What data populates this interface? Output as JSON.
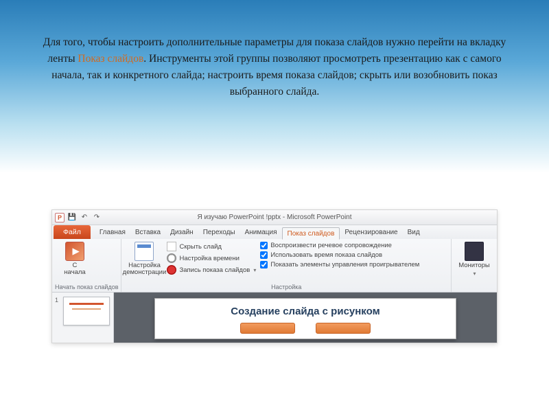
{
  "description": {
    "line1_pre": "Для того, чтобы настроить дополнительные параметры для показа слайдов нужно перейти на вкладку ленты ",
    "highlight": "Показ слайдов",
    "line1_post": ".",
    "line2": "Инструменты этой группы позволяют просмотреть презентацию как с самого начала, так и конкретного слайда; настроить время показа слайдов; скрыть или возобновить показ выбранного слайда."
  },
  "titlebar": {
    "title": "Я изучаю PowerPoint !pptx  -  Microsoft PowerPoint"
  },
  "tabs": {
    "file": "Файл",
    "items": [
      "Главная",
      "Вставка",
      "Дизайн",
      "Переходы",
      "Анимация",
      "Показ слайдов",
      "Рецензирование",
      "Вид"
    ],
    "active_index": 5
  },
  "ribbon": {
    "start_group": {
      "from_beginning": "С\nначала",
      "label": "Начать показ слайдов"
    },
    "setup_group": {
      "setup_btn": "Настройка\nдемонстрации",
      "hide": "Скрыть слайд",
      "rehearse": "Настройка времени",
      "record": "Запись показа слайдов",
      "chk_narration": "Воспроизвести речевое сопровождение",
      "chk_timings": "Использовать время показа слайдов",
      "chk_controls": "Показать элементы управления проигрывателем",
      "label": "Настройка"
    },
    "monitors_group": {
      "monitors": "Мониторы"
    }
  },
  "workspace": {
    "thumb_number": "1",
    "page_title": "Создание слайда с рисунком"
  }
}
